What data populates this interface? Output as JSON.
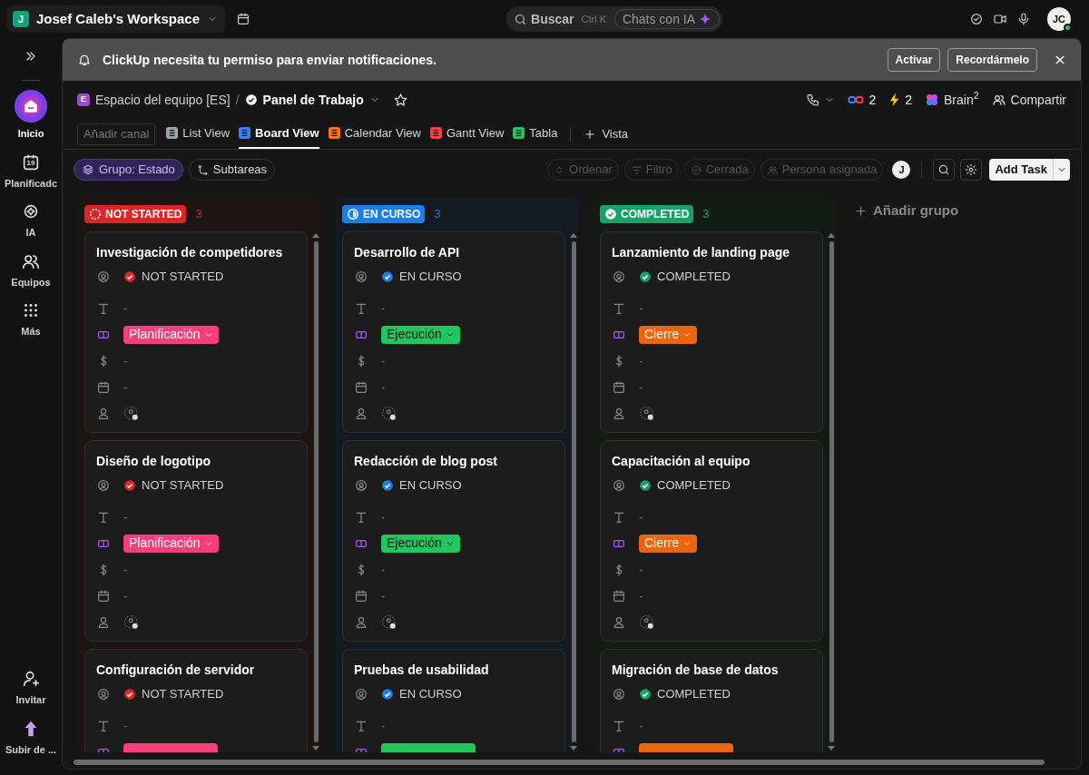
{
  "workspace": {
    "initial": "J",
    "name": "Josef Caleb's Workspace"
  },
  "search": {
    "label": "Buscar",
    "shortcut": "Ctrl K",
    "ai_chat": "Chats con IA"
  },
  "user": {
    "initials": "JC"
  },
  "sidebar": {
    "items": [
      {
        "label": "Inicio",
        "selected": true
      },
      {
        "label": "Planificadc",
        "selected": false,
        "day": "19"
      },
      {
        "label": "IA",
        "selected": false
      },
      {
        "label": "Equipos",
        "selected": false
      },
      {
        "label": "Más",
        "selected": false
      }
    ],
    "bottom_items": [
      {
        "label": "Invitar"
      },
      {
        "label": "Subir de ..."
      }
    ]
  },
  "notification": {
    "text": "ClickUp necesita tu permiso para enviar notificaciones.",
    "buttons": [
      "Activar",
      "Recordármelo"
    ]
  },
  "breadcrumb": {
    "space_initial": "E",
    "space": "Espacio del equipo [ES]",
    "separator": "/",
    "page": "Panel de Trabajo"
  },
  "header_actions": {
    "agents_count": "2",
    "automations_count": "2",
    "brain": "Brain$^{2}$",
    "share": "Compartir"
  },
  "views": {
    "add_channel": "Añadir canal",
    "tabs": [
      {
        "label": "List View",
        "selected": false
      },
      {
        "label": "Board View",
        "selected": true
      },
      {
        "label": "Calendar View",
        "selected": false
      },
      {
        "label": "Gantt View",
        "selected": false
      },
      {
        "label": "Tabla",
        "selected": false
      }
    ],
    "add_view": "Vista"
  },
  "toolbar": {
    "group": "Grupo: Estado",
    "subtasks": "Subtareas",
    "filters": [
      {
        "label": "Ordenar",
        "disabled": true
      },
      {
        "label": "Filtro",
        "disabled": true
      },
      {
        "label": "Cerrada",
        "disabled": true
      },
      {
        "label": "Persona asignada",
        "disabled": true
      }
    ],
    "avatar": "J",
    "add_task": "Add Task"
  },
  "columns": [
    {
      "status": "NOT STARTED",
      "kind": "not_started",
      "color": "#dc2626",
      "count": "3",
      "cards": [
        {
          "title": "Investigación de competidores",
          "status": "NOT STARTED",
          "text_value": "-",
          "tag": {
            "label": "Planificación",
            "color": "#f43f7a"
          },
          "money": "-",
          "date": "-"
        },
        {
          "title": "Diseño de logotipo",
          "status": "NOT STARTED",
          "text_value": "-",
          "tag": {
            "label": "Planificación",
            "color": "#f43f7a"
          },
          "money": "-",
          "date": "-"
        },
        {
          "title": "Configuración de servidor",
          "status": "NOT STARTED",
          "text_value": "-",
          "tag": {
            "color": "#f43f7a"
          }
        }
      ]
    },
    {
      "status": "EN CURSO",
      "kind": "in_progress",
      "color": "#1d7ee6",
      "count": "3",
      "cards": [
        {
          "title": "Desarrollo de API",
          "status": "EN CURSO",
          "text_value": "-",
          "tag": {
            "label": "Ejecución",
            "color": "#22c55e"
          },
          "money": "-",
          "date": "-"
        },
        {
          "title": "Redacción de blog post",
          "status": "EN CURSO",
          "text_value": "-",
          "tag": {
            "label": "Ejecución",
            "color": "#22c55e"
          },
          "money": "-",
          "date": "-"
        },
        {
          "title": "Pruebas de usabilidad",
          "status": "EN CURSO",
          "text_value": "-",
          "tag": {
            "color": "#22c55e"
          }
        }
      ]
    },
    {
      "status": "COMPLETED",
      "kind": "completed",
      "color": "#16a36a",
      "count": "3",
      "cards": [
        {
          "title": "Lanzamiento de landing page",
          "status": "COMPLETED",
          "text_value": "-",
          "tag": {
            "label": "Cierre",
            "color": "#ea650c"
          },
          "money": "-",
          "date": "-"
        },
        {
          "title": "Capacitación al equipo",
          "status": "COMPLETED",
          "text_value": "-",
          "tag": {
            "label": "Cierre",
            "color": "#ea650c"
          },
          "money": "-",
          "date": "-"
        },
        {
          "title": "Migración de base de datos",
          "status": "COMPLETED",
          "text_value": "-",
          "tag": {
            "color": "#ea650c"
          }
        }
      ]
    }
  ],
  "add_group": "Añadir grupo"
}
